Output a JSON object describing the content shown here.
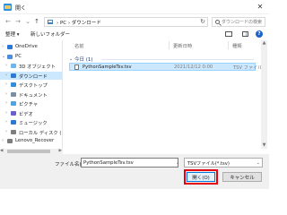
{
  "window": {
    "title": "開く",
    "close_glyph": "✕"
  },
  "address": {
    "path_text": "› PC › ダウンロード",
    "refresh_glyph": "↻",
    "search_placeholder": "ダウンロードの検索"
  },
  "nav_buttons": {
    "back": "←",
    "forward": "→",
    "up_history": "⌄",
    "up": "↑"
  },
  "toolbar": {
    "organize_label": "整理 ▾",
    "new_folder_label": "新しいフォルダー",
    "help_glyph": "?"
  },
  "sidebar": {
    "items": [
      {
        "label": "OneDrive",
        "expand": "›",
        "icon": "cloud-icon",
        "color": "#2a7ad5"
      },
      {
        "label": "PC",
        "expand": "⌄",
        "icon": "pc-icon",
        "color": "#4a90d9"
      },
      {
        "label": "3D オブジェクト",
        "expand": "›",
        "icon": "cube-icon",
        "color": "#6cb6f0"
      },
      {
        "label": "ダウンロード",
        "expand": "›",
        "icon": "download-icon",
        "color": "#2a7ad5",
        "selected": true
      },
      {
        "label": "デスクトップ",
        "expand": "›",
        "icon": "desktop-icon",
        "color": "#2f8fdc"
      },
      {
        "label": "ドキュメント",
        "expand": "›",
        "icon": "document-icon",
        "color": "#7a8ea6"
      },
      {
        "label": "ピクチャ",
        "expand": "›",
        "icon": "picture-icon",
        "color": "#4fa3e0"
      },
      {
        "label": "ビデオ",
        "expand": "›",
        "icon": "video-icon",
        "color": "#6a5fcf"
      },
      {
        "label": "ミュージック",
        "expand": "›",
        "icon": "music-icon",
        "color": "#2a7ad5"
      },
      {
        "label": "ローカル ディスク (",
        "expand": "›",
        "icon": "disk-icon",
        "color": "#7d7d7d"
      },
      {
        "label": "Lenovo_Recover",
        "expand": "›",
        "icon": "drive-icon",
        "color": "#7d7d7d"
      }
    ]
  },
  "columns": {
    "name": "名前",
    "updated": "更新日時",
    "type": "種類"
  },
  "group": {
    "chevron": "⌄",
    "label": "今日 (1)"
  },
  "files": [
    {
      "name": "PythonSampleTsv.tsv",
      "updated": "2021/12/12 0:00",
      "type": "TSV ファイル"
    }
  ],
  "scroll": {
    "up": "▲",
    "down": "▼",
    "left": "◀",
    "right": "▶"
  },
  "footer": {
    "filename_label": "ファイル名(N):",
    "filename_value": "PythonSampleTsv.tsv",
    "dropdown_glyph": "⌄",
    "filetype_value": "TSVファイル(*.tsv)",
    "open_label": "開く(O)",
    "cancel_label": "キャンセル"
  },
  "colors": {
    "selection": "#cce8ff",
    "accent": "#0078d7",
    "highlight_box": "#e60012"
  }
}
